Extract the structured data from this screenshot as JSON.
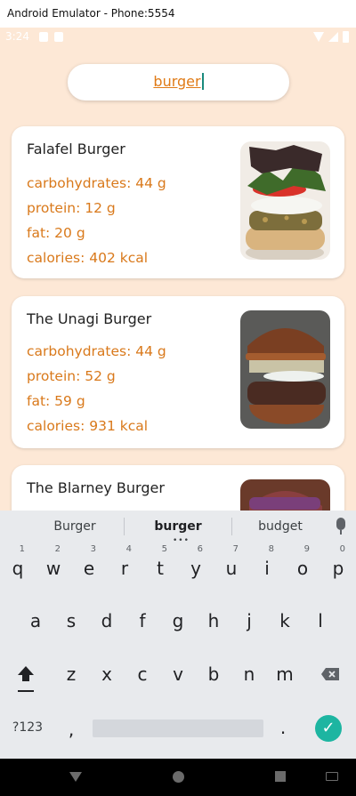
{
  "window": {
    "title": "Android Emulator - Phone:5554"
  },
  "status_bar": {
    "time": "3:24",
    "icons": [
      "notification-icon",
      "sd-card-icon",
      "wifi-icon",
      "signal-icon",
      "battery-icon"
    ]
  },
  "search": {
    "value": "burger"
  },
  "recipes": [
    {
      "name": "Falafel Burger",
      "carbohydrates": "carbohydrates: 44 g",
      "protein": "protein: 12 g",
      "fat": "fat: 20 g",
      "calories": "calories: 402 kcal"
    },
    {
      "name": "The Unagi Burger",
      "carbohydrates": "carbohydrates: 44 g",
      "protein": "protein: 52 g",
      "fat": "fat: 59 g",
      "calories": "calories: 931 kcal"
    },
    {
      "name": "The Blarney Burger"
    }
  ],
  "keyboard": {
    "suggestions": [
      "Burger",
      "burger",
      "budget"
    ],
    "row1": [
      "q",
      "w",
      "e",
      "r",
      "t",
      "y",
      "u",
      "i",
      "o",
      "p"
    ],
    "row1_hints": [
      "1",
      "2",
      "3",
      "4",
      "5",
      "6",
      "7",
      "8",
      "9",
      "0"
    ],
    "row2": [
      "a",
      "s",
      "d",
      "f",
      "g",
      "h",
      "j",
      "k",
      "l"
    ],
    "row3": [
      "z",
      "x",
      "c",
      "v",
      "b",
      "n",
      "m"
    ],
    "symbols_label": "?123",
    "comma": ",",
    "period": "."
  },
  "colors": {
    "background": "#fde8d6",
    "nutrient_text": "#d9791b",
    "accent": "#1db5a1"
  }
}
